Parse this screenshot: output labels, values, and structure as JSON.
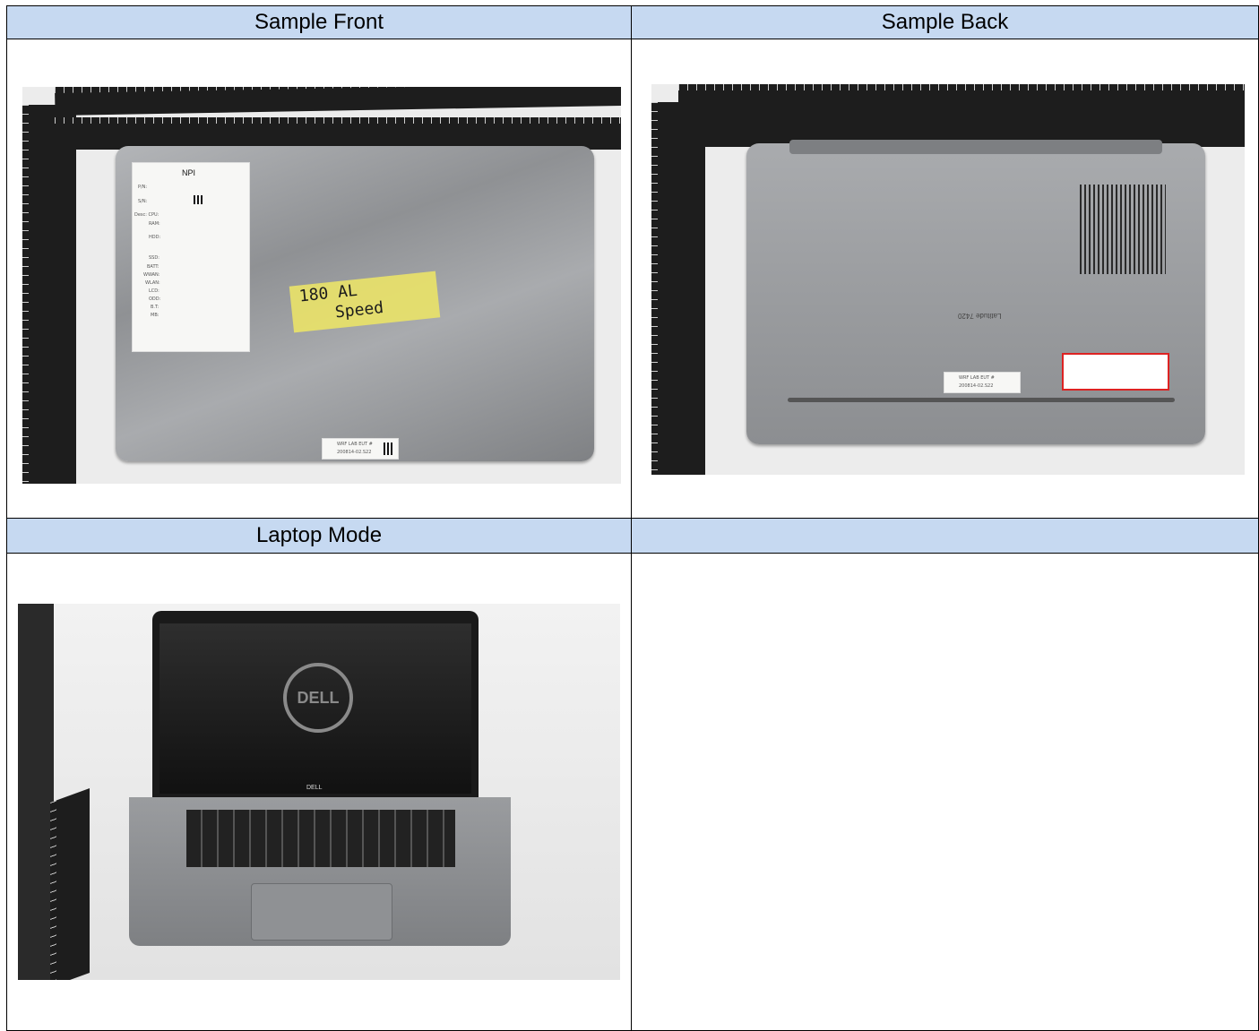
{
  "headers": {
    "top_left": "Sample Front",
    "top_right": "Sample Back",
    "bottom_left": "Laptop Mode",
    "bottom_right": ""
  },
  "photo_text": {
    "front_sticker_title": "NPI",
    "tape_text_line1": "180 AL",
    "tape_text_line2": "Speed",
    "eut_label": "WRF LAB EUT #",
    "eut_number": "200814-02.S22",
    "back_model": "Latitude 7420",
    "screen_logo": "DELL",
    "bezel_logo": "DELL"
  },
  "front_sticker_rows": [
    "P/N:",
    "S/N:",
    "Desc:  CPU:",
    "RAM:",
    "HDD:",
    "SSD:",
    "BATT:",
    "WWAN:",
    "WLAN:",
    "LCD:",
    "ODD:",
    "B.T:",
    "MB:"
  ]
}
